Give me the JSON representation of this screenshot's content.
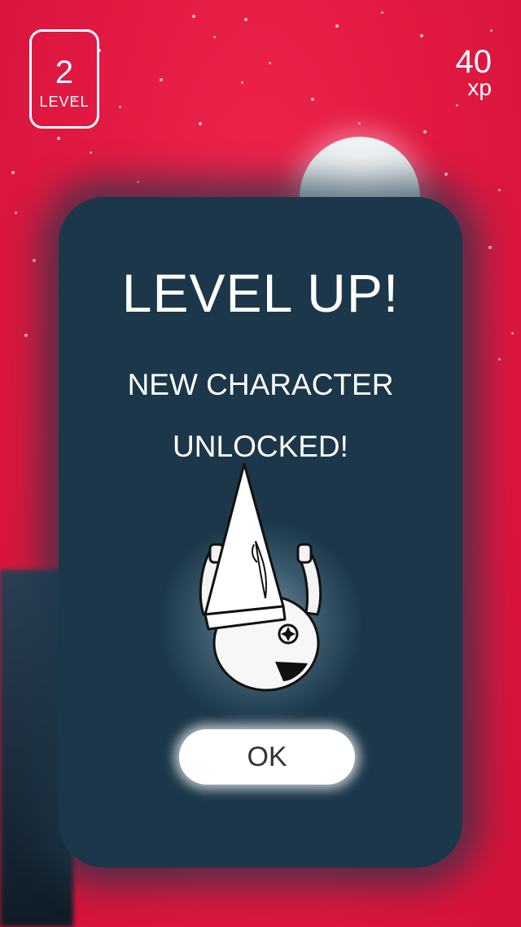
{
  "hud": {
    "level_number": "2",
    "level_label": "LEVEL",
    "xp_value": "40",
    "xp_unit": "xp"
  },
  "dialog": {
    "title": "LEVEL UP!",
    "subtitle_line1": "NEW CHARACTER",
    "subtitle_line2": "UNLOCKED!",
    "ok_label": "OK"
  },
  "colors": {
    "background": "#e31a43",
    "card": "#1b3749",
    "text": "#ffffff"
  },
  "icons": {
    "character": "wizard-hat-character-icon",
    "moon": "moon-icon"
  }
}
